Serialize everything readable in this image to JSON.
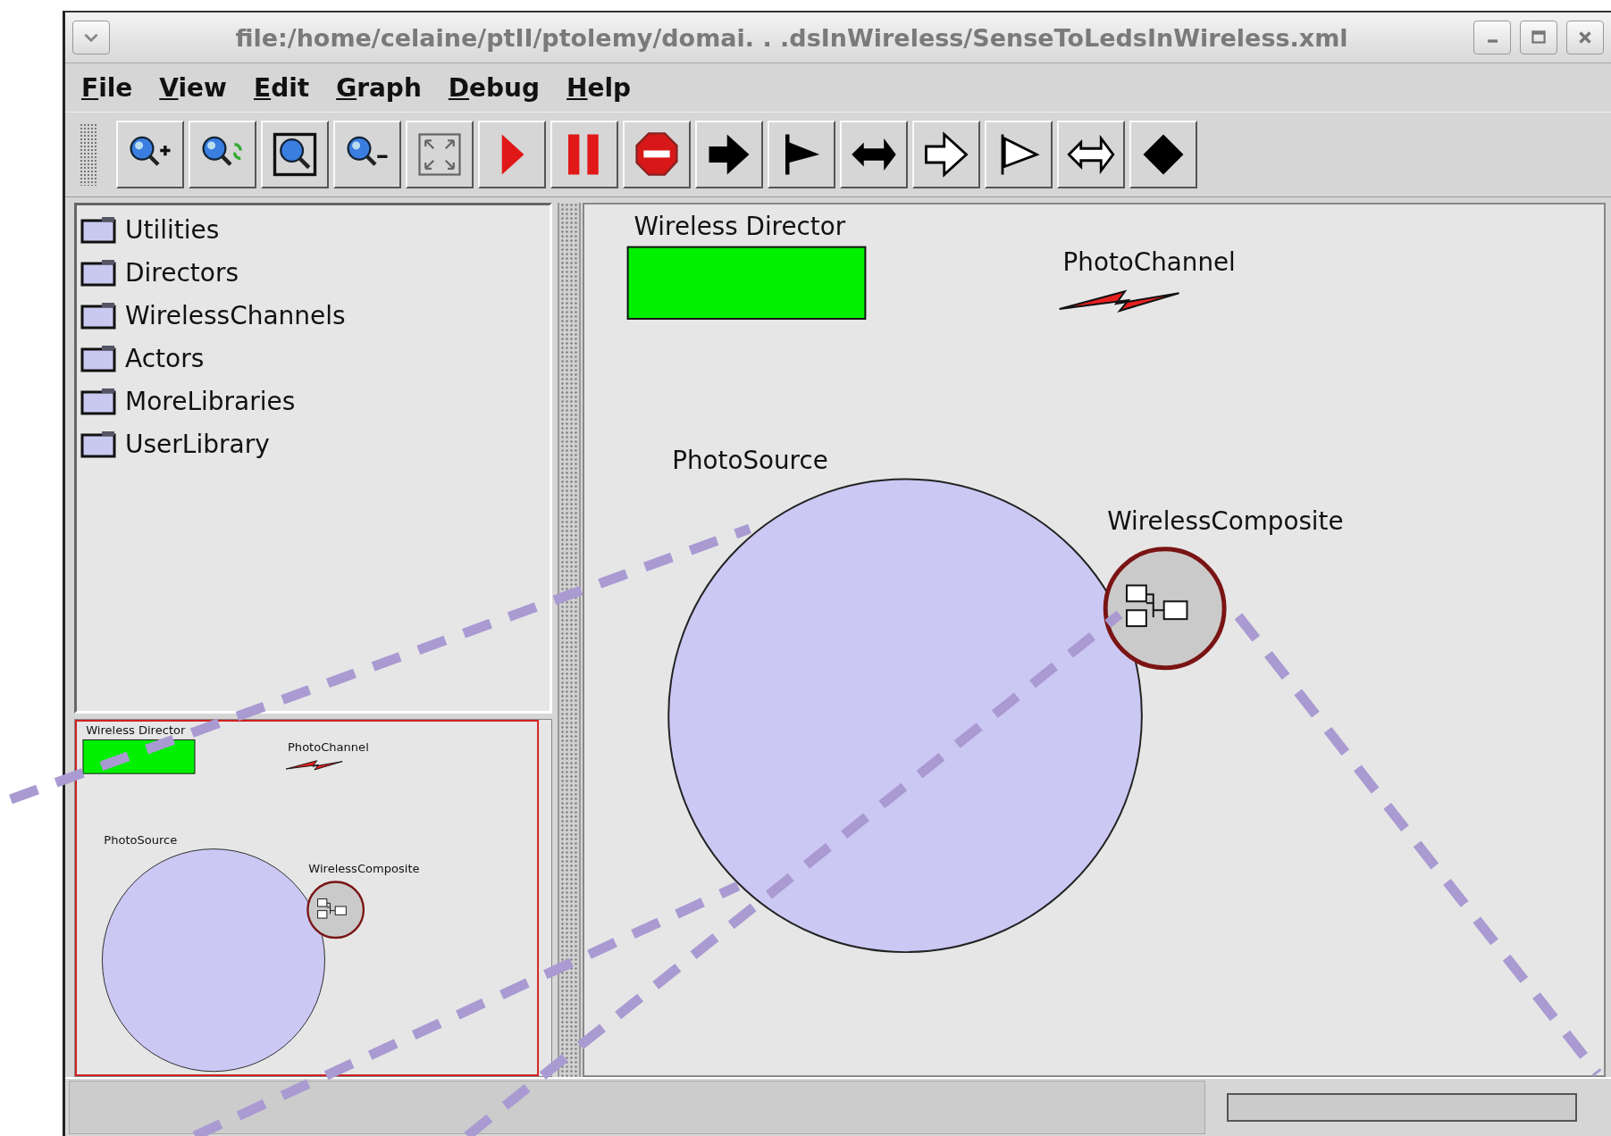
{
  "window": {
    "title": "file:/home/celaine/ptII/ptolemy/domai. . .dsInWireless/SenseToLedsInWireless.xml"
  },
  "menu": [
    "File",
    "View",
    "Edit",
    "Graph",
    "Debug",
    "Help"
  ],
  "toolbar": [
    {
      "kind": "zoom_in"
    },
    {
      "kind": "zoom_reset"
    },
    {
      "kind": "zoom_fit"
    },
    {
      "kind": "zoom_out"
    },
    {
      "kind": "full_screen"
    },
    {
      "kind": "run"
    },
    {
      "kind": "pause"
    },
    {
      "kind": "stop"
    },
    {
      "kind": "input_port"
    },
    {
      "kind": "output_port"
    },
    {
      "kind": "inout_port"
    },
    {
      "kind": "input_multiport"
    },
    {
      "kind": "output_multiport"
    },
    {
      "kind": "inout_multiport"
    },
    {
      "kind": "relation"
    }
  ],
  "library": {
    "items": [
      {
        "label": "Utilities"
      },
      {
        "label": "Directors"
      },
      {
        "label": "WirelessChannels"
      },
      {
        "label": "Actors"
      },
      {
        "label": "MoreLibraries"
      },
      {
        "label": "UserLibrary"
      }
    ]
  },
  "canvas": {
    "entities": [
      {
        "kind": "director",
        "label": "Wireless Director"
      },
      {
        "kind": "channel",
        "label": "PhotoChannel"
      },
      {
        "kind": "source",
        "label": "PhotoSource"
      },
      {
        "kind": "composite",
        "label": "WirelessComposite"
      }
    ]
  },
  "overview": {
    "entities": [
      {
        "kind": "director",
        "label": "Wireless Director"
      },
      {
        "kind": "channel",
        "label": "PhotoChannel"
      },
      {
        "kind": "source",
        "label": "PhotoSource"
      },
      {
        "kind": "composite",
        "label": "WirelessComposite"
      }
    ]
  },
  "status_bar": {
    "progress": {
      "level": 0
    }
  }
}
